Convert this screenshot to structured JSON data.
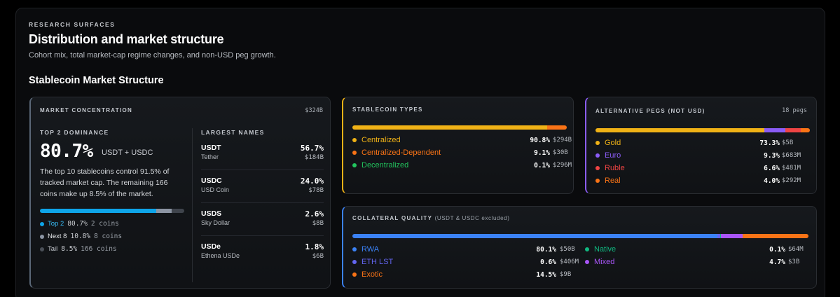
{
  "header": {
    "eyebrow": "RESEARCH SURFACES",
    "title": "Distribution and market structure",
    "subtitle": "Cohort mix, total market-cap regime changes, and non-USD peg growth."
  },
  "section_title": "Stablecoin Market Structure",
  "market_concentration": {
    "label": "MARKET CONCENTRATION",
    "total": "$324B",
    "dominance_label": "TOP 2 DOMINANCE",
    "dominance_value": "80.7%",
    "dominance_tag": "USDT + USDC",
    "description": "The top 10 stablecoins control 91.5% of tracked market cap. The remaining 166 coins make up 8.5% of the market.",
    "bar": [
      {
        "name": "Top 2",
        "fraction": 80.7,
        "color": "#0ea5e9"
      },
      {
        "name": "Next 8",
        "fraction": 10.8,
        "color": "#8c95a3"
      },
      {
        "name": "Tail",
        "fraction": 8.5,
        "color": "#3f444c"
      }
    ],
    "legend": [
      {
        "name": "Top 2",
        "pct": "80.7%",
        "count": "2 coins",
        "color": "#0ea5e9",
        "name_color": "#38bdf8"
      },
      {
        "name": "Next 8",
        "pct": "10.8%",
        "count": "8 coins",
        "color": "#8c95a3",
        "name_color": "#e6e8eb"
      },
      {
        "name": "Tail",
        "pct": "8.5%",
        "count": "166 coins",
        "color": "#4b5058",
        "name_color": "#c4c8ce"
      }
    ],
    "largest_label": "LARGEST NAMES",
    "largest": [
      {
        "symbol": "USDT",
        "name": "Tether",
        "pct": "56.7%",
        "cap": "$184B"
      },
      {
        "symbol": "USDC",
        "name": "USD Coin",
        "pct": "24.0%",
        "cap": "$78B"
      },
      {
        "symbol": "USDS",
        "name": "Sky Dollar",
        "pct": "2.6%",
        "cap": "$8B"
      },
      {
        "symbol": "USDe",
        "name": "Ethena USDe",
        "pct": "1.8%",
        "cap": "$6B"
      }
    ]
  },
  "stablecoin_types": {
    "label": "STABLECOIN TYPES",
    "bar": [
      {
        "fraction": 90.8,
        "color": "#f0b216"
      },
      {
        "fraction": 9.1,
        "color": "#f97316"
      },
      {
        "fraction": 0.1,
        "color": "#22c55e"
      }
    ],
    "items": [
      {
        "name": "Centralized",
        "pct": "90.8%",
        "value": "$294B",
        "color": "#f0b216"
      },
      {
        "name": "Centralized-Dependent",
        "pct": "9.1%",
        "value": "$30B",
        "color": "#f97316"
      },
      {
        "name": "Decentralized",
        "pct": "0.1%",
        "value": "$296M",
        "color": "#22c55e"
      }
    ]
  },
  "alternative_pegs": {
    "label": "ALTERNATIVE PEGS (NOT USD)",
    "count": "18 pegs",
    "bar": [
      {
        "fraction": 73.3,
        "color": "#f0b216"
      },
      {
        "fraction": 9.3,
        "color": "#8b5cf6"
      },
      {
        "fraction": 6.6,
        "color": "#ef4444"
      },
      {
        "fraction": 4.0,
        "color": "#f97316"
      }
    ],
    "items": [
      {
        "name": "Gold",
        "pct": "73.3%",
        "value": "$5B",
        "color": "#f0b216"
      },
      {
        "name": "Euro",
        "pct": "9.3%",
        "value": "$683M",
        "color": "#8b5cf6"
      },
      {
        "name": "Ruble",
        "pct": "6.6%",
        "value": "$481M",
        "color": "#ef4444"
      },
      {
        "name": "Real",
        "pct": "4.0%",
        "value": "$292M",
        "color": "#f97316"
      }
    ]
  },
  "collateral_quality": {
    "label": "COLLATERAL QUALITY",
    "label_note": "(USDT & USDC excluded)",
    "bar": [
      {
        "fraction": 80.1,
        "color": "#3b82f6"
      },
      {
        "fraction": 0.6,
        "color": "#6366f1"
      },
      {
        "fraction": 0.1,
        "color": "#10b981"
      },
      {
        "fraction": 4.7,
        "color": "#a855f7"
      },
      {
        "fraction": 14.5,
        "color": "#f97316"
      }
    ],
    "left_items": [
      {
        "name": "RWA",
        "pct": "80.1%",
        "value": "$50B",
        "color": "#3b82f6"
      },
      {
        "name": "ETH LST",
        "pct": "0.6%",
        "value": "$406M",
        "color": "#6366f1"
      },
      {
        "name": "Exotic",
        "pct": "14.5%",
        "value": "$9B",
        "color": "#f97316"
      }
    ],
    "right_items": [
      {
        "name": "Native",
        "pct": "0.1%",
        "value": "$64M",
        "color": "#10b981"
      },
      {
        "name": "Mixed",
        "pct": "4.7%",
        "value": "$3B",
        "color": "#a855f7"
      }
    ]
  }
}
